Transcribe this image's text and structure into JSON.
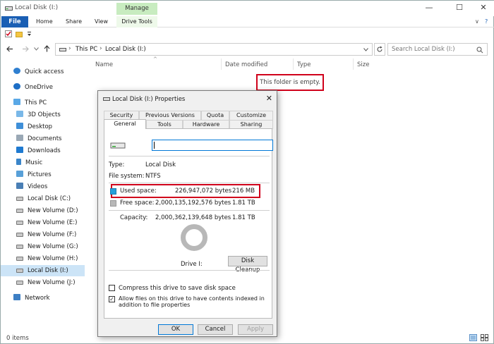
{
  "window": {
    "title": "Local Disk (I:)",
    "controls": {
      "minimize": "—",
      "maximize": "☐",
      "close": "✕"
    }
  },
  "ribbon": {
    "file": "File",
    "tabs": [
      "Home",
      "Share",
      "View"
    ],
    "manage": "Manage",
    "drive_tools": "Drive Tools",
    "collapse": "∨",
    "help": "?"
  },
  "address": {
    "path": [
      "This PC",
      "Local Disk (I:)"
    ],
    "sep": "›",
    "search_placeholder": "Search Local Disk (I:)"
  },
  "columns": [
    "Name",
    "Date modified",
    "Type",
    "Size"
  ],
  "sort_arrow": "^",
  "nav": {
    "items": [
      {
        "label": "Quick access",
        "icon": "star-icon"
      },
      {
        "label": "OneDrive",
        "icon": "cloud-icon"
      },
      {
        "label": "This PC",
        "icon": "computer-icon"
      },
      {
        "label": "3D Objects",
        "icon": "3d-objects-icon"
      },
      {
        "label": "Desktop",
        "icon": "desktop-icon"
      },
      {
        "label": "Documents",
        "icon": "documents-icon"
      },
      {
        "label": "Downloads",
        "icon": "downloads-icon"
      },
      {
        "label": "Music",
        "icon": "music-icon"
      },
      {
        "label": "Pictures",
        "icon": "pictures-icon"
      },
      {
        "label": "Videos",
        "icon": "videos-icon"
      },
      {
        "label": "Local Disk (C:)",
        "icon": "drive-icon"
      },
      {
        "label": "New Volume (D:)",
        "icon": "drive-icon"
      },
      {
        "label": "New Volume (E:)",
        "icon": "drive-icon"
      },
      {
        "label": "New Volume (F:)",
        "icon": "drive-icon"
      },
      {
        "label": "New Volume (G:)",
        "icon": "drive-icon"
      },
      {
        "label": "New Volume (H:)",
        "icon": "drive-icon"
      },
      {
        "label": "Local Disk (I:)",
        "icon": "drive-icon"
      },
      {
        "label": "New Volume (J:)",
        "icon": "drive-icon"
      },
      {
        "label": "Network",
        "icon": "network-icon"
      }
    ]
  },
  "content": {
    "empty": "This folder is empty."
  },
  "status": {
    "items": "0 items"
  },
  "dialog": {
    "title": "Local Disk (I:) Properties",
    "close": "✕",
    "tabs_back": [
      "Security",
      "Previous Versions",
      "Quota",
      "Customize"
    ],
    "tabs_front": [
      "General",
      "Tools",
      "Hardware",
      "Sharing"
    ],
    "name_value": "",
    "type_label": "Type:",
    "type_value": "Local Disk",
    "fs_label": "File system:",
    "fs_value": "NTFS",
    "used": {
      "label": "Used space:",
      "bytes": "226,947,072 bytes",
      "size": "216 MB",
      "color": "#26a0da"
    },
    "free": {
      "label": "Free space:",
      "bytes": "2,000,135,192,576 bytes",
      "size": "1.81 TB",
      "color": "#b8b8b8"
    },
    "capacity": {
      "label": "Capacity:",
      "bytes": "2,000,362,139,648 bytes",
      "size": "1.81 TB"
    },
    "drive_label": "Drive I:",
    "cleanup": "Disk Cleanup",
    "compress": "Compress this drive to save disk space",
    "index": "Allow files on this drive to have contents indexed in addition to file properties",
    "check": "✓",
    "ok": "OK",
    "cancel": "Cancel",
    "apply": "Apply"
  }
}
